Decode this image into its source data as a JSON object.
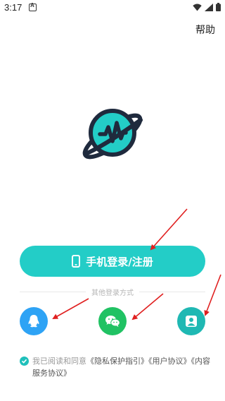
{
  "status_bar": {
    "time": "3:17"
  },
  "header": {
    "help_label": "帮助"
  },
  "login": {
    "phone_button_label": "手机登录/注册",
    "other_methods_label": "其他登录方式",
    "methods": [
      {
        "name": "qq",
        "icon": "qq-icon",
        "color": "#2ea3f5"
      },
      {
        "name": "wechat",
        "icon": "wechat-icon",
        "color": "#20c263"
      },
      {
        "name": "account",
        "icon": "user-icon",
        "color": "#1fb8b3"
      }
    ]
  },
  "agreement": {
    "checked": true,
    "prefix": "我已阅读和同意",
    "privacy": "《隐私保护指引》",
    "user": "《用户协议》",
    "content": "《内容服务协议》"
  },
  "colors": {
    "accent": "#23cdc7",
    "annotation": "#e02020"
  }
}
